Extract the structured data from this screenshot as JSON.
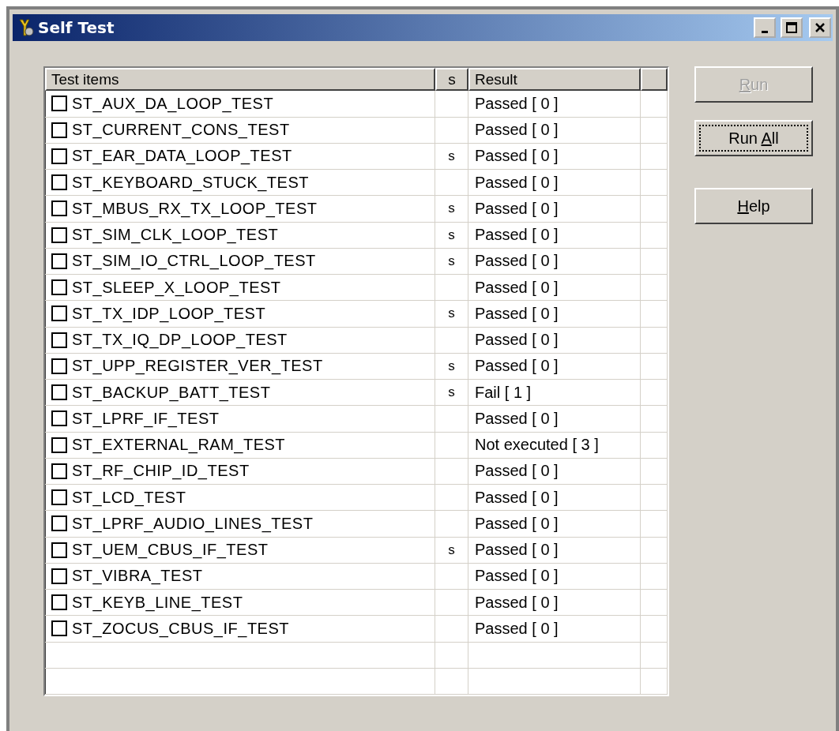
{
  "window": {
    "title": "Self Test"
  },
  "table": {
    "columns": [
      "Test items",
      "s",
      "Result"
    ],
    "rows": [
      {
        "checked": false,
        "name": "ST_AUX_DA_LOOP_TEST",
        "s": "",
        "result": "Passed [ 0 ]"
      },
      {
        "checked": false,
        "name": "ST_CURRENT_CONS_TEST",
        "s": "",
        "result": "Passed [ 0 ]"
      },
      {
        "checked": false,
        "name": "ST_EAR_DATA_LOOP_TEST",
        "s": "s",
        "result": "Passed [ 0 ]"
      },
      {
        "checked": false,
        "name": "ST_KEYBOARD_STUCK_TEST",
        "s": "",
        "result": "Passed [ 0 ]"
      },
      {
        "checked": false,
        "name": "ST_MBUS_RX_TX_LOOP_TEST",
        "s": "s",
        "result": "Passed [ 0 ]"
      },
      {
        "checked": false,
        "name": "ST_SIM_CLK_LOOP_TEST",
        "s": "s",
        "result": "Passed [ 0 ]"
      },
      {
        "checked": false,
        "name": "ST_SIM_IO_CTRL_LOOP_TEST",
        "s": "s",
        "result": "Passed [ 0 ]"
      },
      {
        "checked": false,
        "name": "ST_SLEEP_X_LOOP_TEST",
        "s": "",
        "result": "Passed [ 0 ]"
      },
      {
        "checked": false,
        "name": "ST_TX_IDP_LOOP_TEST",
        "s": "s",
        "result": "Passed [ 0 ]"
      },
      {
        "checked": false,
        "name": "ST_TX_IQ_DP_LOOP_TEST",
        "s": "",
        "result": "Passed [ 0 ]"
      },
      {
        "checked": false,
        "name": "ST_UPP_REGISTER_VER_TEST",
        "s": "s",
        "result": "Passed [ 0 ]"
      },
      {
        "checked": false,
        "name": "ST_BACKUP_BATT_TEST",
        "s": "s",
        "result": "Fail [ 1 ]"
      },
      {
        "checked": false,
        "name": "ST_LPRF_IF_TEST",
        "s": "",
        "result": "Passed [ 0 ]"
      },
      {
        "checked": false,
        "name": "ST_EXTERNAL_RAM_TEST",
        "s": "",
        "result": "Not executed [ 3 ]"
      },
      {
        "checked": false,
        "name": "ST_RF_CHIP_ID_TEST",
        "s": "",
        "result": "Passed [ 0 ]"
      },
      {
        "checked": false,
        "name": "ST_LCD_TEST",
        "s": "",
        "result": "Passed [ 0 ]"
      },
      {
        "checked": false,
        "name": "ST_LPRF_AUDIO_LINES_TEST",
        "s": "",
        "result": "Passed [ 0 ]"
      },
      {
        "checked": false,
        "name": "ST_UEM_CBUS_IF_TEST",
        "s": "s",
        "result": "Passed [ 0 ]"
      },
      {
        "checked": false,
        "name": "ST_VIBRA_TEST",
        "s": "",
        "result": "Passed [ 0 ]"
      },
      {
        "checked": false,
        "name": "ST_KEYB_LINE_TEST",
        "s": "",
        "result": "Passed [ 0 ]"
      },
      {
        "checked": false,
        "name": "ST_ZOCUS_CBUS_IF_TEST",
        "s": "",
        "result": "Passed [ 0 ]"
      }
    ]
  },
  "buttons": [
    {
      "key": "R",
      "after": "un",
      "disabled": true,
      "focused": false
    },
    {
      "before": "Run ",
      "key": "A",
      "after": "ll",
      "disabled": false,
      "focused": true
    },
    {
      "key": "H",
      "after": "elp",
      "disabled": false,
      "focused": false
    }
  ]
}
